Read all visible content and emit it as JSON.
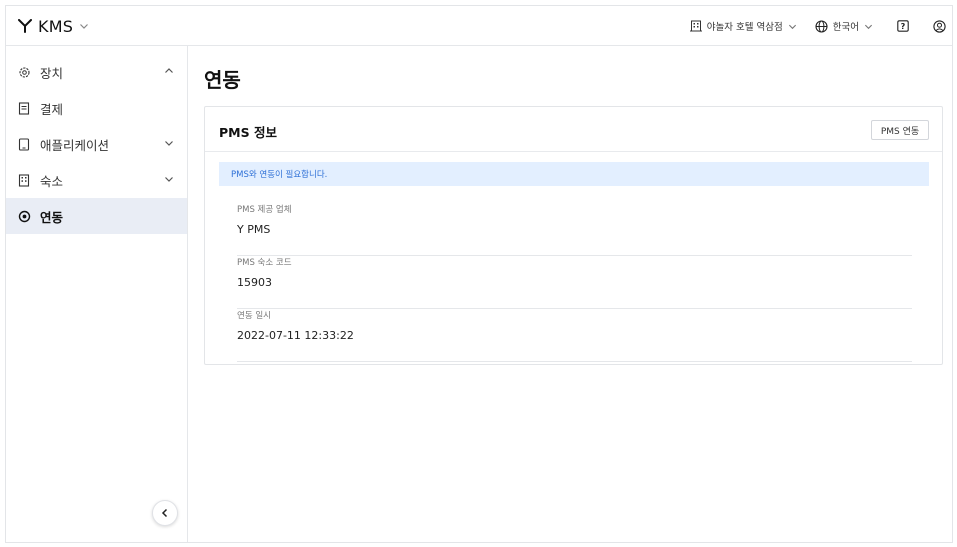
{
  "header": {
    "app_name": "KMS",
    "property": "야놀자 호텔 역삼점",
    "language": "한국어",
    "help_icon": "help-square-icon",
    "account_icon": "user-circle-icon"
  },
  "sidebar": {
    "items": [
      {
        "label": "장치",
        "icon": "gear-icon",
        "caret": "up"
      },
      {
        "label": "결제",
        "icon": "receipt-icon",
        "caret": ""
      },
      {
        "label": "애플리케이션",
        "icon": "tablet-icon",
        "caret": "down"
      },
      {
        "label": "숙소",
        "icon": "building-icon",
        "caret": "down"
      },
      {
        "label": "연동",
        "icon": "link-eye-icon",
        "caret": "",
        "active": true
      }
    ]
  },
  "main": {
    "title": "연동",
    "card": {
      "title": "PMS 정보",
      "button_label": "PMS 연동",
      "alert": "PMS와 연동이 필요합니다.",
      "fields": [
        {
          "label": "PMS 제공 업체",
          "value": "Y PMS"
        },
        {
          "label": "PMS 숙소 코드",
          "value": "15903"
        },
        {
          "label": "연동 일시",
          "value": "2022-07-11 12:33:22"
        }
      ]
    }
  },
  "colors": {
    "active_bg": "#e9edf5",
    "alert_bg": "#e3efff",
    "alert_text": "#2d6fd6"
  }
}
